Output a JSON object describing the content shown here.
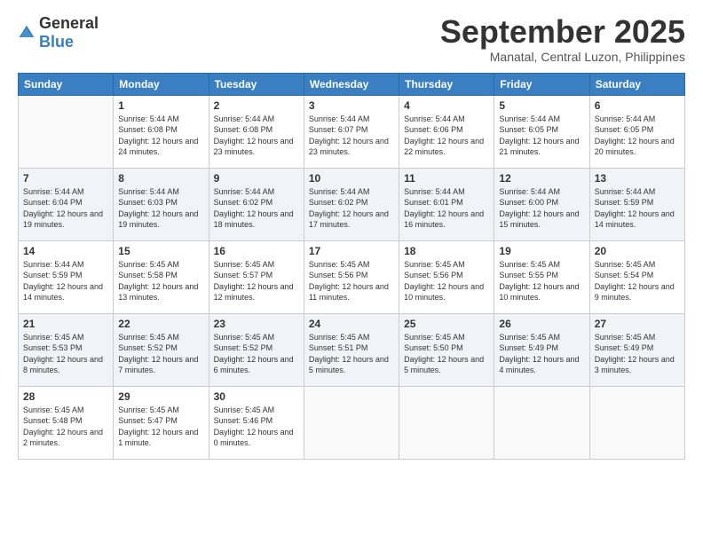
{
  "logo": {
    "general": "General",
    "blue": "Blue"
  },
  "header": {
    "month": "September 2025",
    "location": "Manatal, Central Luzon, Philippines"
  },
  "weekdays": [
    "Sunday",
    "Monday",
    "Tuesday",
    "Wednesday",
    "Thursday",
    "Friday",
    "Saturday"
  ],
  "weeks": [
    [
      {
        "day": "",
        "sunrise": "",
        "sunset": "",
        "daylight": ""
      },
      {
        "day": "1",
        "sunrise": "Sunrise: 5:44 AM",
        "sunset": "Sunset: 6:08 PM",
        "daylight": "Daylight: 12 hours and 24 minutes."
      },
      {
        "day": "2",
        "sunrise": "Sunrise: 5:44 AM",
        "sunset": "Sunset: 6:08 PM",
        "daylight": "Daylight: 12 hours and 23 minutes."
      },
      {
        "day": "3",
        "sunrise": "Sunrise: 5:44 AM",
        "sunset": "Sunset: 6:07 PM",
        "daylight": "Daylight: 12 hours and 23 minutes."
      },
      {
        "day": "4",
        "sunrise": "Sunrise: 5:44 AM",
        "sunset": "Sunset: 6:06 PM",
        "daylight": "Daylight: 12 hours and 22 minutes."
      },
      {
        "day": "5",
        "sunrise": "Sunrise: 5:44 AM",
        "sunset": "Sunset: 6:05 PM",
        "daylight": "Daylight: 12 hours and 21 minutes."
      },
      {
        "day": "6",
        "sunrise": "Sunrise: 5:44 AM",
        "sunset": "Sunset: 6:05 PM",
        "daylight": "Daylight: 12 hours and 20 minutes."
      }
    ],
    [
      {
        "day": "7",
        "sunrise": "Sunrise: 5:44 AM",
        "sunset": "Sunset: 6:04 PM",
        "daylight": "Daylight: 12 hours and 19 minutes."
      },
      {
        "day": "8",
        "sunrise": "Sunrise: 5:44 AM",
        "sunset": "Sunset: 6:03 PM",
        "daylight": "Daylight: 12 hours and 19 minutes."
      },
      {
        "day": "9",
        "sunrise": "Sunrise: 5:44 AM",
        "sunset": "Sunset: 6:02 PM",
        "daylight": "Daylight: 12 hours and 18 minutes."
      },
      {
        "day": "10",
        "sunrise": "Sunrise: 5:44 AM",
        "sunset": "Sunset: 6:02 PM",
        "daylight": "Daylight: 12 hours and 17 minutes."
      },
      {
        "day": "11",
        "sunrise": "Sunrise: 5:44 AM",
        "sunset": "Sunset: 6:01 PM",
        "daylight": "Daylight: 12 hours and 16 minutes."
      },
      {
        "day": "12",
        "sunrise": "Sunrise: 5:44 AM",
        "sunset": "Sunset: 6:00 PM",
        "daylight": "Daylight: 12 hours and 15 minutes."
      },
      {
        "day": "13",
        "sunrise": "Sunrise: 5:44 AM",
        "sunset": "Sunset: 5:59 PM",
        "daylight": "Daylight: 12 hours and 14 minutes."
      }
    ],
    [
      {
        "day": "14",
        "sunrise": "Sunrise: 5:44 AM",
        "sunset": "Sunset: 5:59 PM",
        "daylight": "Daylight: 12 hours and 14 minutes."
      },
      {
        "day": "15",
        "sunrise": "Sunrise: 5:45 AM",
        "sunset": "Sunset: 5:58 PM",
        "daylight": "Daylight: 12 hours and 13 minutes."
      },
      {
        "day": "16",
        "sunrise": "Sunrise: 5:45 AM",
        "sunset": "Sunset: 5:57 PM",
        "daylight": "Daylight: 12 hours and 12 minutes."
      },
      {
        "day": "17",
        "sunrise": "Sunrise: 5:45 AM",
        "sunset": "Sunset: 5:56 PM",
        "daylight": "Daylight: 12 hours and 11 minutes."
      },
      {
        "day": "18",
        "sunrise": "Sunrise: 5:45 AM",
        "sunset": "Sunset: 5:56 PM",
        "daylight": "Daylight: 12 hours and 10 minutes."
      },
      {
        "day": "19",
        "sunrise": "Sunrise: 5:45 AM",
        "sunset": "Sunset: 5:55 PM",
        "daylight": "Daylight: 12 hours and 10 minutes."
      },
      {
        "day": "20",
        "sunrise": "Sunrise: 5:45 AM",
        "sunset": "Sunset: 5:54 PM",
        "daylight": "Daylight: 12 hours and 9 minutes."
      }
    ],
    [
      {
        "day": "21",
        "sunrise": "Sunrise: 5:45 AM",
        "sunset": "Sunset: 5:53 PM",
        "daylight": "Daylight: 12 hours and 8 minutes."
      },
      {
        "day": "22",
        "sunrise": "Sunrise: 5:45 AM",
        "sunset": "Sunset: 5:52 PM",
        "daylight": "Daylight: 12 hours and 7 minutes."
      },
      {
        "day": "23",
        "sunrise": "Sunrise: 5:45 AM",
        "sunset": "Sunset: 5:52 PM",
        "daylight": "Daylight: 12 hours and 6 minutes."
      },
      {
        "day": "24",
        "sunrise": "Sunrise: 5:45 AM",
        "sunset": "Sunset: 5:51 PM",
        "daylight": "Daylight: 12 hours and 5 minutes."
      },
      {
        "day": "25",
        "sunrise": "Sunrise: 5:45 AM",
        "sunset": "Sunset: 5:50 PM",
        "daylight": "Daylight: 12 hours and 5 minutes."
      },
      {
        "day": "26",
        "sunrise": "Sunrise: 5:45 AM",
        "sunset": "Sunset: 5:49 PM",
        "daylight": "Daylight: 12 hours and 4 minutes."
      },
      {
        "day": "27",
        "sunrise": "Sunrise: 5:45 AM",
        "sunset": "Sunset: 5:49 PM",
        "daylight": "Daylight: 12 hours and 3 minutes."
      }
    ],
    [
      {
        "day": "28",
        "sunrise": "Sunrise: 5:45 AM",
        "sunset": "Sunset: 5:48 PM",
        "daylight": "Daylight: 12 hours and 2 minutes."
      },
      {
        "day": "29",
        "sunrise": "Sunrise: 5:45 AM",
        "sunset": "Sunset: 5:47 PM",
        "daylight": "Daylight: 12 hours and 1 minute."
      },
      {
        "day": "30",
        "sunrise": "Sunrise: 5:45 AM",
        "sunset": "Sunset: 5:46 PM",
        "daylight": "Daylight: 12 hours and 0 minutes."
      },
      {
        "day": "",
        "sunrise": "",
        "sunset": "",
        "daylight": ""
      },
      {
        "day": "",
        "sunrise": "",
        "sunset": "",
        "daylight": ""
      },
      {
        "day": "",
        "sunrise": "",
        "sunset": "",
        "daylight": ""
      },
      {
        "day": "",
        "sunrise": "",
        "sunset": "",
        "daylight": ""
      }
    ]
  ]
}
